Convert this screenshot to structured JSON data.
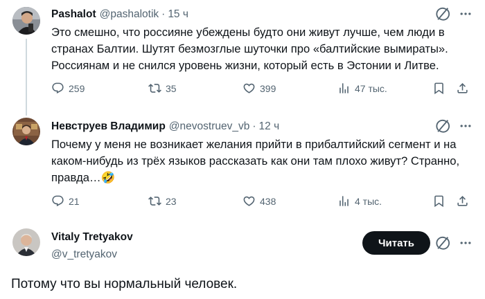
{
  "tweets": [
    {
      "name": "Pashalot",
      "handle": "@pashalotik",
      "time": "15 ч",
      "text": "Это смешно, что россияне убеждены будто они живут лучше, чем люди в странах Балтии. Шутят безмозглые шуточки про «балтийские вымираты». Россиянам и не снился уровень жизни, который есть в Эстонии и Литве.",
      "replies": "259",
      "reposts": "35",
      "likes": "399",
      "views": "47 тыс."
    },
    {
      "name": "Невструев Владимир",
      "handle": "@nevostruev_vb",
      "time": "12 ч",
      "text": "Почему у меня не возникает желания прийти в прибалтийский сегмент и на каком-нибудь из трёх языков рассказать как они там плохо живут? Странно, правда…",
      "emoji": "🤣",
      "replies": "21",
      "reposts": "23",
      "likes": "438",
      "views": "4 тыс."
    }
  ],
  "reply": {
    "name": "Vitaly Tretyakov",
    "handle": "@v_tretyakov",
    "follow_label": "Читать",
    "text": "Потому что вы нормальный человек."
  },
  "colors": {
    "text": "#0f1419",
    "secondary": "#536471",
    "thread_line": "#cfd9de",
    "button_bg": "#0f1419"
  },
  "icons": [
    "grok-icon",
    "more-icon",
    "reply-icon",
    "repost-icon",
    "like-icon",
    "views-icon",
    "bookmark-icon",
    "share-icon"
  ]
}
